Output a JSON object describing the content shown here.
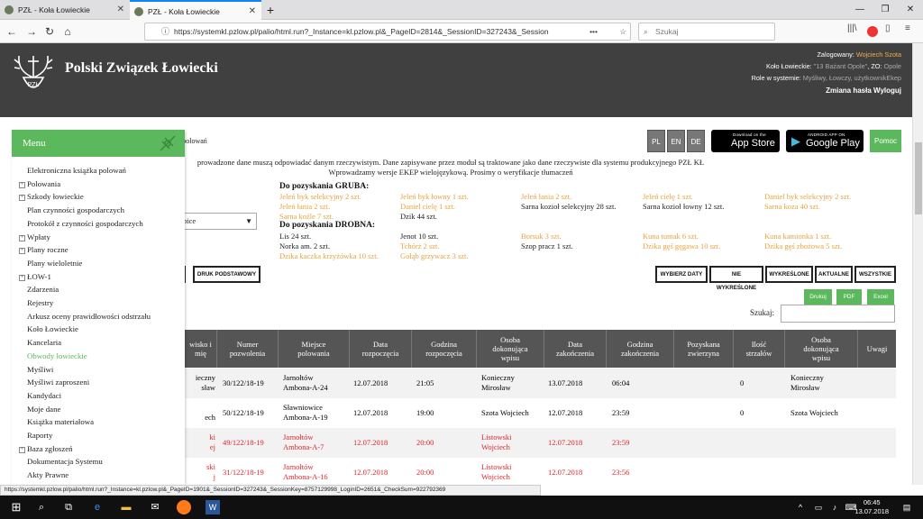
{
  "browser": {
    "tabs": [
      {
        "title": "PZŁ - Koła Łowieckie",
        "active": false
      },
      {
        "title": "PZŁ - Koła Łowieckie",
        "active": true
      }
    ],
    "url": "https://systemkl.pzlow.pl/palio/html.run?_Instance=kl.pzlow.pl&_PageID=2814&_SessionID=327243&_Session",
    "search_placeholder": "Szukaj",
    "status_url": "https://systemkl.pzlow.pl/palio/html.run?_Instance=kl.pzlow.pl&_PageID=1901&_SessionID=327243&_SessionKey=8757129998_LoginID=2651&_CheckSum=922792369"
  },
  "header": {
    "brand": "Polski Związek Łowiecki",
    "logged_label": "Zalogowany:",
    "logged_user": "Wojciech Szota",
    "club_label": "Koło Łowieckie:",
    "club_name": "\"13 Bażant Opole\"",
    "zo_label": ", ZO:",
    "zo_name": "Opole",
    "role_label": "Role w systemie:",
    "role_value": "Myśliwy, Łowczy, użytkownikEkep",
    "change_password": "Zmiana hasła",
    "logout": "Wyloguj"
  },
  "toolbar": {
    "languages": [
      "PL",
      "EN",
      "DE"
    ],
    "appstore_small": "Download on the",
    "appstore_big": "App Store",
    "googleplay_small": "ANDROID APP ON",
    "googleplay_big": "Google Play",
    "help": "Pomoc"
  },
  "page": {
    "breadcrumb_fragment": "i polowań",
    "notice_line1": "prowadzone dane muszą odpowiadać danym rzeczywistym. Dane zapisywane przez moduł są traktowane jako dane rzeczywiste dla systemu produkcyjnego PZŁ KŁ",
    "notice_line2": "Wprowadzamy wersje EKEP wielojęzykową. Prosimy o weryfikacje tłumaczeń",
    "select_value": "pice",
    "print_button": "DRUK PODSTAWOWY",
    "filters": [
      "WYBIERZ DATY",
      "NIE WYKREŚLONE",
      "WYKREŚLONE",
      "AKTUALNE",
      "WSZYSTKIE"
    ],
    "exports": [
      "Drukuj",
      "PDF",
      "Excel"
    ],
    "search_label": "Szukaj:"
  },
  "quota": {
    "gruba_title": "Do pozyskania GRUBA:",
    "drobna_title": "Do pozyskania DROBNA:",
    "gruba": [
      [
        "Jeleń byk selekcyjny 2 szt.",
        "Jeleń łania 2 szt.",
        "Sarna koźle 7 szt."
      ],
      [
        "Jeleń byk łowny 1 szt.",
        "Daniel cielę 1 szt.",
        "Dzik 44 szt."
      ],
      [
        "Jeleń łania 2 szt.",
        "Sarna kozioł selekcyjny 28 szt."
      ],
      [
        "Jeleń cielę 1 szt.",
        "Sarna kozioł łowny 12 szt."
      ],
      [
        "Daniel byk selekcyjny 2 szt.",
        "Sarna koza 40 szt."
      ]
    ],
    "drobna": [
      [
        "Lis 24 szt.",
        "Norka am. 2 szt.",
        "Dzika kaczka krzyżówka 10 szt."
      ],
      [
        "Jenot 10 szt.",
        "Tchórz 2 szt.",
        "Gołąb grzywacz 3 szt."
      ],
      [
        "Borsuk 3 szt.",
        "Szop pracz 1 szt."
      ],
      [
        "Kuna tumak 6 szt.",
        "Dzika gęś gęgawa 10 szt."
      ],
      [
        "Kuna kamionka 1 szt.",
        "Dzika gęś zbożowa 5 szt."
      ]
    ]
  },
  "table": {
    "columns": [
      "wisko i\nmię",
      "Numer\npozwolenia",
      "Miejsce\npolowania",
      "Data\nrozpoczęcia",
      "Godzina\nrozpoczęcia",
      "Osoba\ndokonująca\nwpisu",
      "Data\nzakończenia",
      "Godzina\nzakończenia",
      "Pozyskana\nzwierzyna",
      "Ilość\nstrzałów",
      "Osoba\ndokonująca\nwpisu",
      "Uwagi"
    ],
    "rows": [
      {
        "name": "ieczny\nsław",
        "permit": "30/122/18-19",
        "place": "Jarnołtów\nAmbona-A-24",
        "start_date": "12.07.2018",
        "start_time": "21:05",
        "person": "Konieczny\nMirosław",
        "end_date": "13.07.2018",
        "end_time": "06:04",
        "game": "",
        "shots": "0",
        "person2": "Konieczny\nMirosław",
        "notes": "",
        "red": false
      },
      {
        "name": "\nech",
        "permit": "50/122/18-19",
        "place": "Sławniowice\nAmbona-A-19",
        "start_date": "12.07.2018",
        "start_time": "19:00",
        "person": "Szota Wojciech",
        "end_date": "12.07.2018",
        "end_time": "23:59",
        "game": "",
        "shots": "0",
        "person2": "Szota Wojciech",
        "notes": "",
        "red": false
      },
      {
        "name": "ki\nej",
        "permit": "49/122/18-19",
        "place": "Jarnołtów\nAmbona-A-7",
        "start_date": "12.07.2018",
        "start_time": "20:00",
        "person": "Listowski\nWojciech",
        "end_date": "12.07.2018",
        "end_time": "23:59",
        "game": "",
        "shots": "",
        "person2": "",
        "notes": "",
        "red": true
      },
      {
        "name": "ski\nj",
        "permit": "31/122/18-19",
        "place": "Jarnołtów\nAmbona-A-16",
        "start_date": "12.07.2018",
        "start_time": "20:00",
        "person": "Listowski\nWojciech",
        "end_date": "12.07.2018",
        "end_time": "23:56",
        "game": "",
        "shots": "",
        "person2": "",
        "notes": "",
        "red": true
      }
    ]
  },
  "sidebar": {
    "title": "Menu",
    "items": [
      {
        "label": "Elektroniczna książka polowań",
        "expandable": false
      },
      {
        "label": "Polowania",
        "expandable": true
      },
      {
        "label": "Szkody łowieckie",
        "expandable": true
      },
      {
        "label": "Plan czynności gospodarczych",
        "expandable": false
      },
      {
        "label": "Protokół z czynności gospodarczych",
        "expandable": false
      },
      {
        "label": "Wpłaty",
        "expandable": true
      },
      {
        "label": "Plany roczne",
        "expandable": true
      },
      {
        "label": "Plany wieloletnie",
        "expandable": false
      },
      {
        "label": "ŁOW-1",
        "expandable": true
      },
      {
        "label": "Zdarzenia",
        "expandable": false
      },
      {
        "label": "Rejestry",
        "expandable": false
      },
      {
        "label": "Arkusz oceny prawidłowości odstrzału",
        "expandable": false
      },
      {
        "label": "Koło Łowieckie",
        "expandable": false
      },
      {
        "label": "Kancelaria",
        "expandable": false
      },
      {
        "label": "Obwody łowieckie",
        "expandable": false,
        "active": true
      },
      {
        "label": "Myśliwi",
        "expandable": false
      },
      {
        "label": "Myśliwi zaproszeni",
        "expandable": false
      },
      {
        "label": "Kandydaci",
        "expandable": false
      },
      {
        "label": "Moje dane",
        "expandable": false
      },
      {
        "label": "Książka materiałowa",
        "expandable": false
      },
      {
        "label": "Raporty",
        "expandable": false
      },
      {
        "label": "Baza zgłoszeń",
        "expandable": true
      },
      {
        "label": "Dokumentacja Systemu",
        "expandable": false
      },
      {
        "label": "Akty Prawne",
        "expandable": false
      }
    ]
  },
  "taskbar": {
    "time": "06:45",
    "date": "13.07.2018"
  },
  "colors": {
    "header_bg": "#404040",
    "accent_green": "#5cb85c",
    "quota_orange": "#e8a33d",
    "row_red": "#e0242a",
    "table_header": "#555555"
  }
}
